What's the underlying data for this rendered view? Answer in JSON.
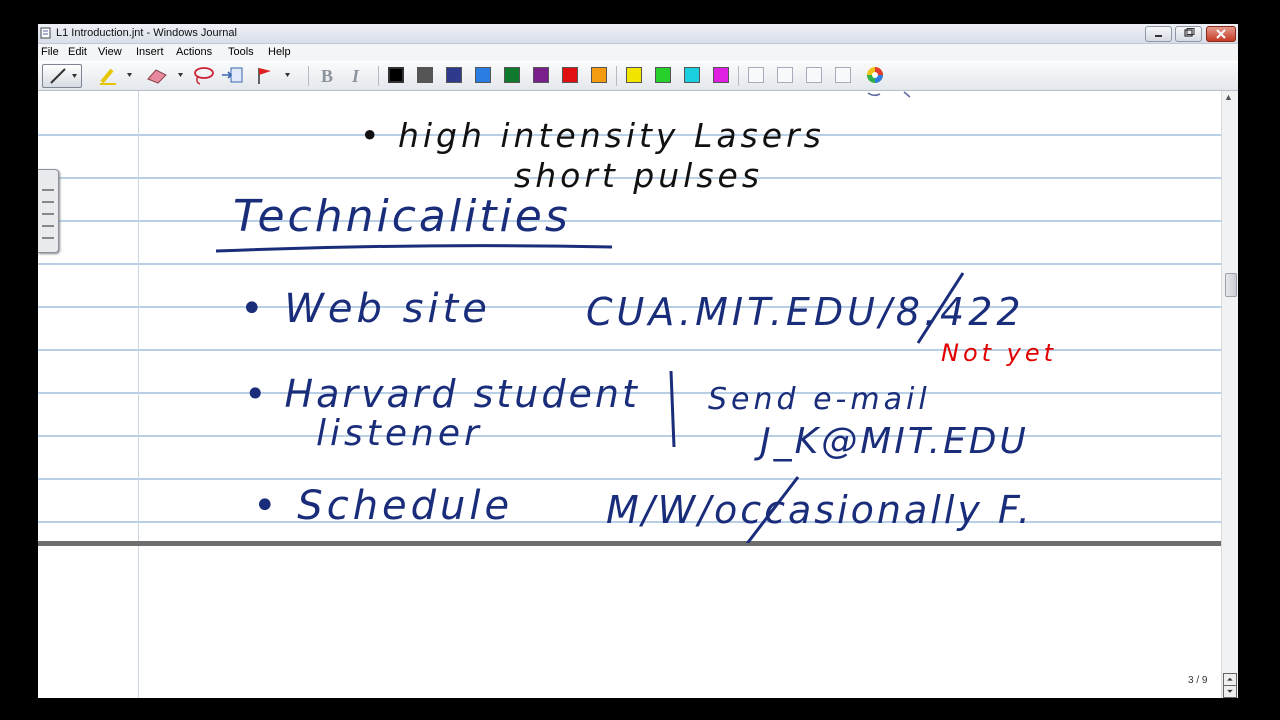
{
  "window": {
    "title": "L1 Introduction.jnt - Windows Journal"
  },
  "menu": {
    "items": [
      "File",
      "Edit",
      "View",
      "Insert",
      "Actions",
      "Tools",
      "Help"
    ]
  },
  "toolbar": {
    "bold_label": "B",
    "italic_label": "I",
    "pen_colors": [
      "#000000",
      "#555555",
      "#2e3a8c",
      "#2a7de1",
      "#0f7a2c",
      "#7a1f8c",
      "#e01010",
      "#f39c12",
      "#f2e600",
      "#27d12b",
      "#1ad0e0",
      "#e020e0"
    ]
  },
  "note": {
    "ink_colors": {
      "blue": "#1a2d7a",
      "red": "#e00000",
      "black": "#111111"
    },
    "lines": [
      {
        "text": "•  high intensity Lasers"
      },
      {
        "text": "short pulses"
      },
      {
        "text": "Technicalities"
      },
      {
        "text": "•  Web site"
      },
      {
        "text": "CUA.MIT.EDU/8.422"
      },
      {
        "text": "Not yet"
      },
      {
        "text": "•  Harvard student"
      },
      {
        "text": "listener"
      },
      {
        "text": "Send e-mail"
      },
      {
        "text": "J_K@MIT.EDU"
      },
      {
        "text": "•  Schedule"
      },
      {
        "text": "M/W/occasionally F."
      }
    ]
  },
  "status": {
    "page_counter": "3 / 9"
  }
}
